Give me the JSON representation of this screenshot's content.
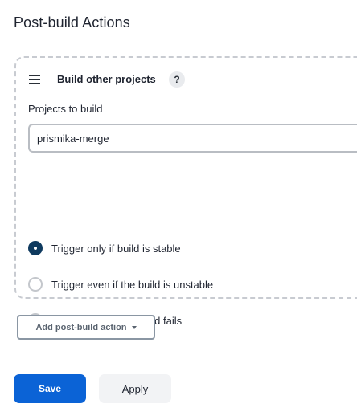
{
  "section": {
    "title": "Post-build Actions"
  },
  "panel": {
    "title": "Build other projects",
    "help_glyph": "?",
    "drag_icon": "hamburger-icon",
    "projects_label": "Projects to build",
    "projects_value": "prismika-merge",
    "trigger_options": [
      {
        "label": "Trigger only if build is stable",
        "selected": true
      },
      {
        "label": "Trigger even if the build is unstable",
        "selected": false
      },
      {
        "label": "Trigger even if the build fails",
        "selected": false
      }
    ]
  },
  "actions": {
    "add_post_build_label": "Add post-build action",
    "save_label": "Save",
    "apply_label": "Apply"
  },
  "colors": {
    "primary": "#0b63d6",
    "radio_selected": "#0f3a5f",
    "dashed_border": "#c8cbd1"
  }
}
